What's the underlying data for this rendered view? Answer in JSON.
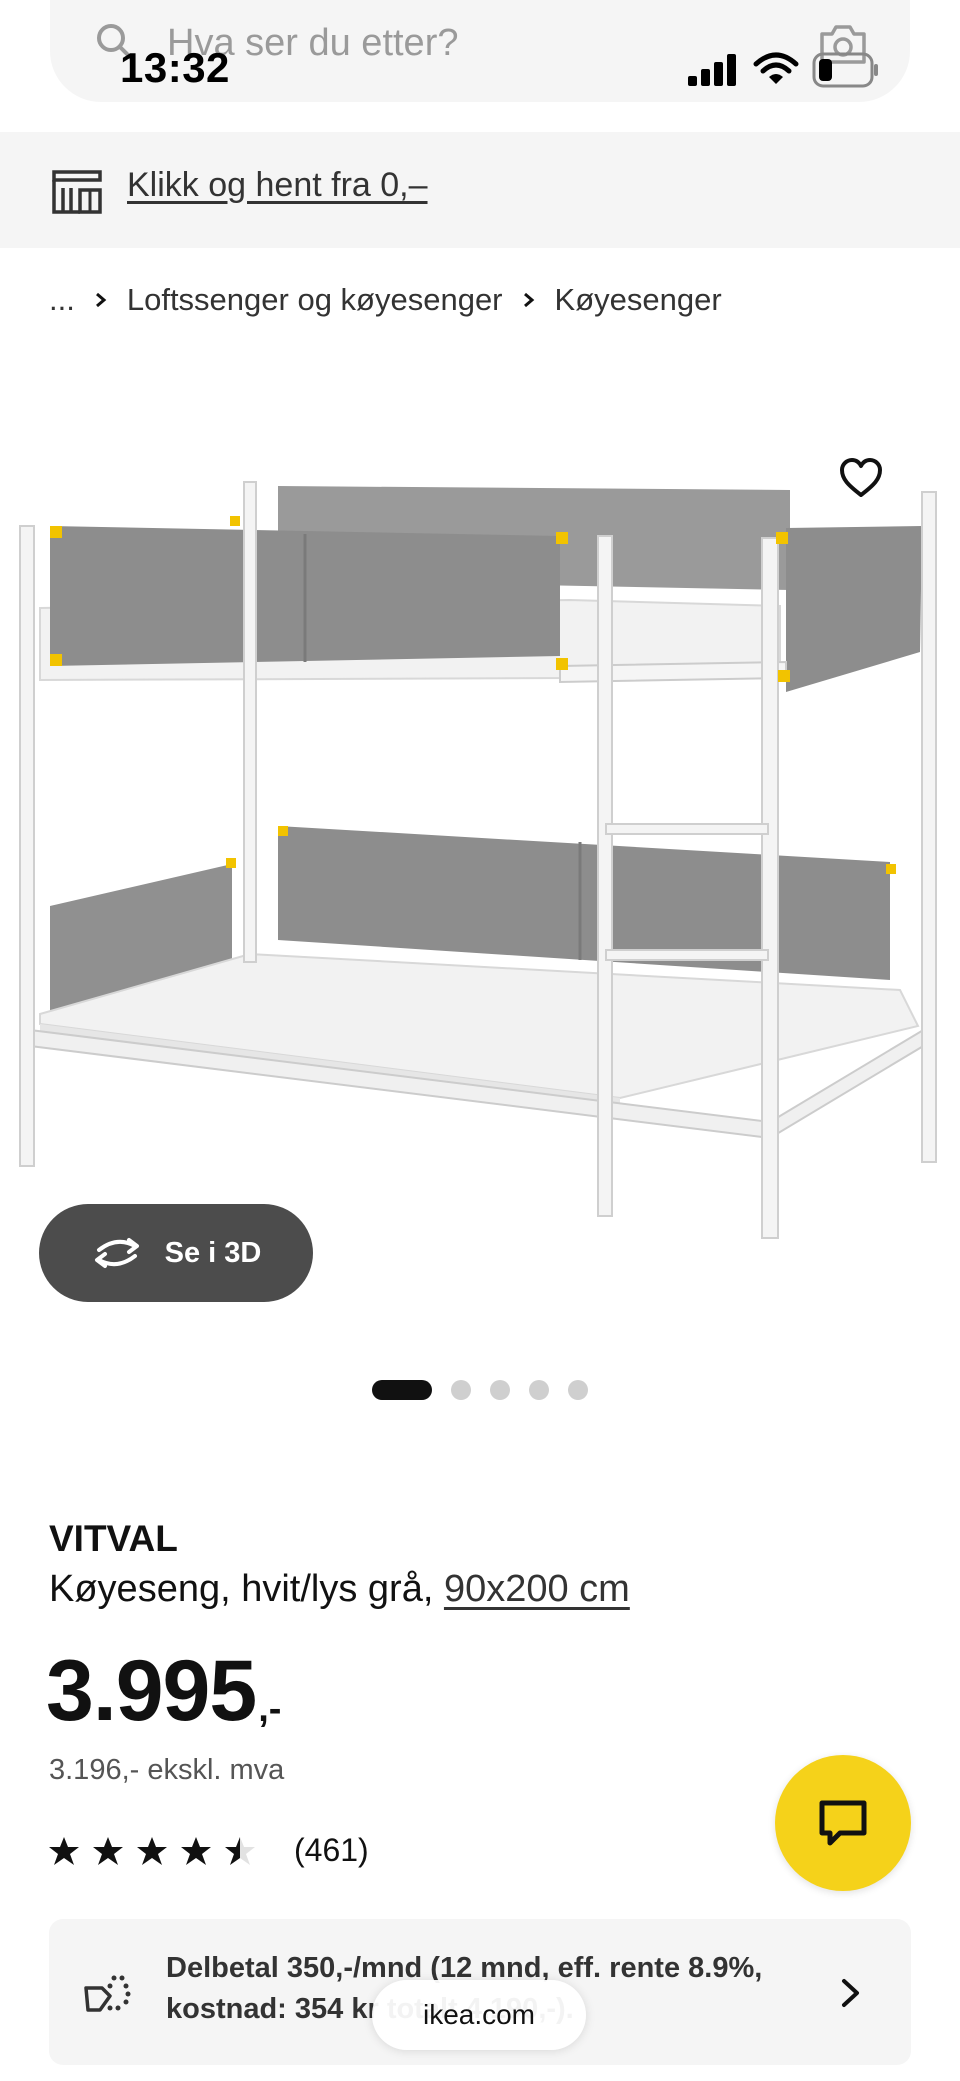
{
  "status_bar": {
    "time": "13:32"
  },
  "search": {
    "placeholder": "Hva ser du etter?"
  },
  "collect_banner": {
    "text": "Klikk og hent fra 0,–"
  },
  "breadcrumb": {
    "ellipsis": "...",
    "items": [
      "Loftssenger og køyesenger",
      "Køyesenger"
    ]
  },
  "view_3d": {
    "label": "Se i 3D"
  },
  "carousel": {
    "total": 5,
    "active_index": 0
  },
  "product": {
    "name": "VITVAL",
    "description": "Køyeseng, hvit/lys grå, ",
    "size": "90x200 cm",
    "price": "3.995",
    "price_suffix": ",-",
    "price_ex_vat": "3.196,- ekskl. mva",
    "rating": 4.5,
    "rating_max": 5,
    "review_count": "(461)"
  },
  "financing": {
    "text": "Delbetal 350,-/mnd (12 mnd, eff. rente 8.9%, kostnad: 354 kr totalt 4.190,-)."
  },
  "browser": {
    "domain": "ikea.com"
  },
  "colors": {
    "accent_yellow": "#F5D21A",
    "banner_bg": "#F5F5F5",
    "dark_button": "#4C4C4C",
    "text_primary": "#111111"
  }
}
